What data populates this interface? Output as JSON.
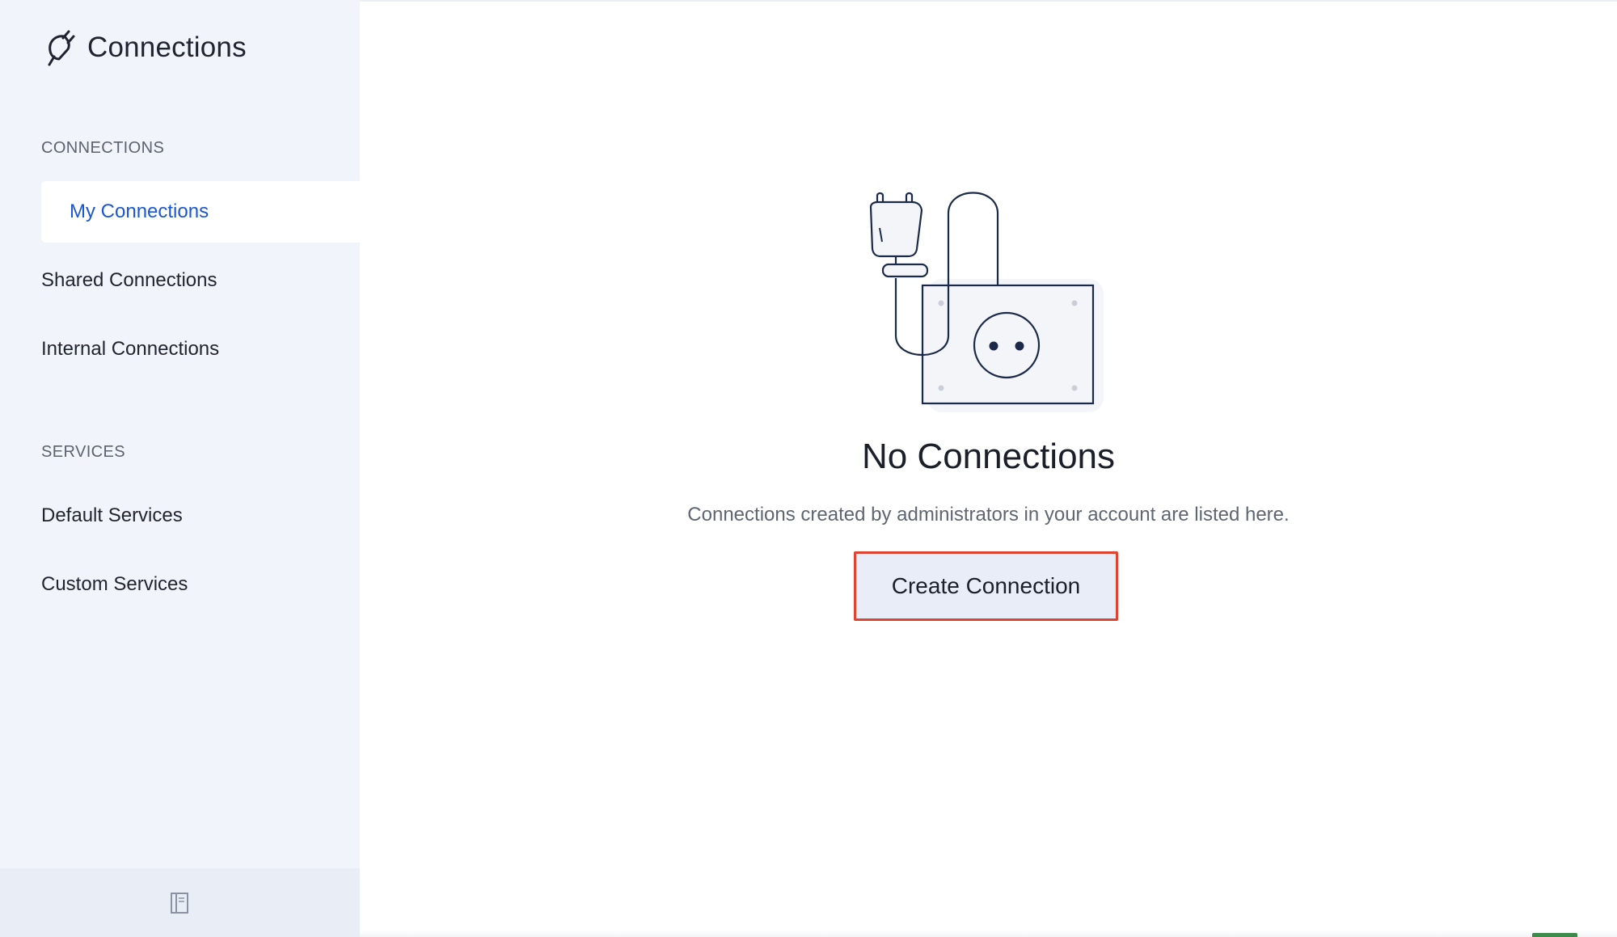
{
  "app": {
    "title": "Connections"
  },
  "sidebar": {
    "sections": [
      {
        "label": "CONNECTIONS",
        "items": [
          {
            "label": "My Connections",
            "active": true
          },
          {
            "label": "Shared Connections",
            "active": false
          },
          {
            "label": "Internal Connections",
            "active": false
          }
        ]
      },
      {
        "label": "SERVICES",
        "items": [
          {
            "label": "Default Services",
            "active": false
          },
          {
            "label": "Custom Services",
            "active": false
          }
        ]
      }
    ],
    "footer_icon": "collapse-sidebar-icon"
  },
  "main": {
    "empty_state": {
      "illustration": "plug-socket-illustration",
      "title": "No Connections",
      "description": "Connections created by administrators in your account are listed here.",
      "button_label": "Create Connection"
    }
  },
  "colors": {
    "sidebar_bg": "#f1f4fa",
    "active_text": "#1a57d6",
    "button_bg": "#e8edf7",
    "button_highlight_border": "#e0432f"
  }
}
